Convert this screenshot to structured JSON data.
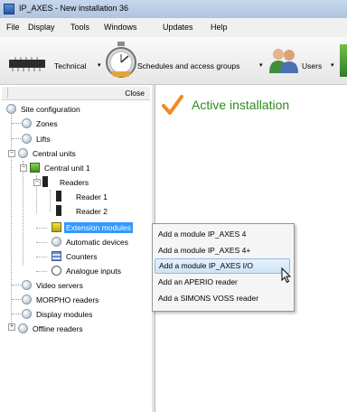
{
  "window": {
    "title": "IP_AXES - New installation 36"
  },
  "menu": [
    "File",
    "Display",
    "Tools",
    "Windows",
    "Updates",
    "Help"
  ],
  "toolbar": {
    "technical": "Technical",
    "schedules": "Schedules and access groups",
    "users": "Users"
  },
  "panel": {
    "close": "Close"
  },
  "tree": {
    "site_configuration": "Site configuration",
    "zones": "Zones",
    "lifts": "Lifts",
    "central_units": "Central units",
    "central_unit_1": "Central unit 1",
    "readers": "Readers",
    "reader_1": "Reader 1",
    "reader_2": "Reader 2",
    "extension_modules": "Extension modules",
    "automatic_devices": "Automatic devices",
    "counters": "Counters",
    "analogue_inputs": "Analogue inputs",
    "video_servers": "Video servers",
    "morpho_readers": "MORPHO readers",
    "display_modules": "Display modules",
    "offline_readers": "Offline readers"
  },
  "main": {
    "status": "Active installation"
  },
  "context_menu": [
    "Add a module IP_AXES 4",
    "Add a module IP_AXES 4+",
    "Add a module IP_AXES I/O",
    "Add an APERIO reader",
    "Add a SIMONS VOSS reader"
  ],
  "colors": {
    "selection": "#3399ff",
    "check": "#f08a24",
    "status_text": "#2f8a1e"
  }
}
